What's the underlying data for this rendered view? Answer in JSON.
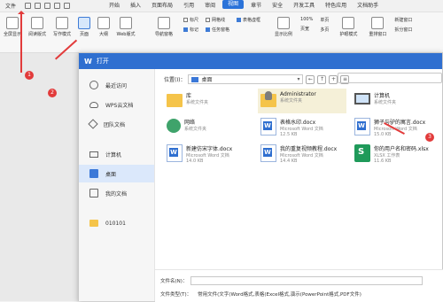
{
  "menu": {
    "file": "文件",
    "tabs": [
      "开始",
      "插入",
      "页面布局",
      "引用",
      "审阅",
      "视图",
      "章节",
      "安全",
      "开发工具",
      "特色应用",
      "文档助手"
    ],
    "active_tab_index": 5
  },
  "ribbon": {
    "buttons": [
      "全屏显示",
      "阅读版式",
      "写作模式",
      "页面",
      "大纲",
      "Web版式"
    ],
    "selected_button_index": 3,
    "nav_pane": "导航窗格",
    "checks1": [
      {
        "label": "标尺",
        "on": false
      },
      {
        "label": "标记",
        "on": true
      }
    ],
    "checks2": [
      {
        "label": "网格线",
        "on": false
      },
      {
        "label": "任务窗格",
        "on": true
      }
    ],
    "checks3": [
      {
        "label": "表格虚框",
        "on": true
      }
    ],
    "zoom": [
      "显示比例",
      "100%",
      "页宽"
    ],
    "pages": [
      "单页",
      "多页"
    ],
    "other": [
      "护眼模式",
      "重排窗口",
      "新建窗口",
      "拆分窗口"
    ]
  },
  "dialog": {
    "title": "打开",
    "logo": "W",
    "location_label": "位置(I)：",
    "location_value": "桌面",
    "nav": [
      {
        "label": "最近访问",
        "icon": "clock-icon"
      },
      {
        "label": "WPS云文档",
        "icon": "cloud-icon"
      },
      {
        "label": "团队文档",
        "icon": "team-icon"
      },
      {
        "label": "计算机",
        "icon": "computer-icon"
      },
      {
        "label": "桌面",
        "icon": "desktop-icon"
      },
      {
        "label": "我的文档",
        "icon": "my-docs-icon"
      },
      {
        "label": "010101",
        "icon": "folder-icon"
      }
    ],
    "active_nav_index": 4,
    "files": [
      {
        "name": "库",
        "type": "系统文件夹",
        "size": "",
        "icon": "library-folder-icon"
      },
      {
        "name": "Administrator",
        "type": "系统文件夹",
        "size": "",
        "icon": "user-folder-icon"
      },
      {
        "name": "计算机",
        "type": "系统文件夹",
        "size": "",
        "icon": "computer-icon"
      },
      {
        "name": "网络",
        "type": "系统文件夹",
        "size": "",
        "icon": "network-icon"
      },
      {
        "name": "表格水印.docx",
        "type": "Microsoft Word 文档",
        "size": "12.5 KB",
        "icon": "word-doc-icon"
      },
      {
        "name": "狮子与驴的寓言.docx",
        "type": "Microsoft Word 文档",
        "size": "15.0 KB",
        "icon": "word-doc-icon"
      },
      {
        "name": "新建仿宋字体.docx",
        "type": "Microsoft Word 文档",
        "size": "14.0 KB",
        "icon": "word-doc-icon"
      },
      {
        "name": "我的重复视频教程.docx",
        "type": "Microsoft Word 文档",
        "size": "14.4 KB",
        "icon": "word-doc-icon"
      },
      {
        "name": "你的用户名和密码.xlsx",
        "type": "XLSX 工作表",
        "size": "11.6 KB",
        "icon": "xlsx-icon"
      }
    ],
    "highlight_index": 1,
    "filename_label": "文件名(N)：",
    "filename_value": "",
    "filetype_label": "文件类型(T)：",
    "filetype_value": "常用文件(文字(Word格式,表格(Excel格式,演示(PowerPoint格式,PDF文件)"
  },
  "annotations": [
    "1",
    "2",
    "3"
  ],
  "colors": {
    "accent": "#2f6fd0",
    "annotation": "#e23b3b"
  }
}
